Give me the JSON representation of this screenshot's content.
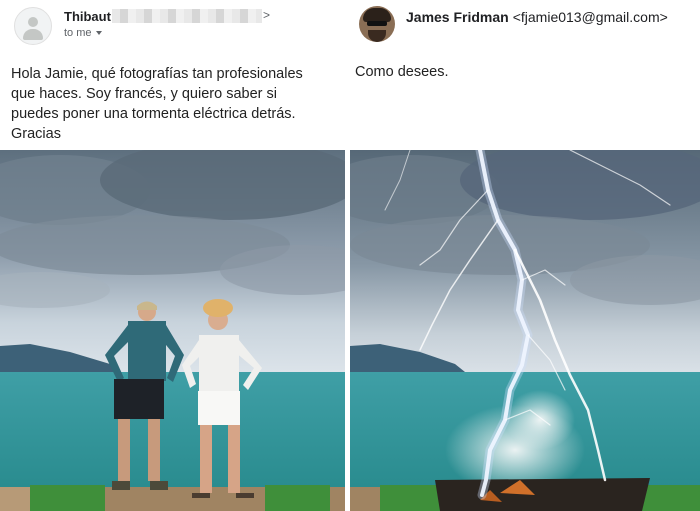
{
  "left_email": {
    "sender_name": "Thibaut",
    "redacted_tail": ">",
    "recipient_line": "to me",
    "message_lines": [
      "Hola Jamie, qué fotografías tan profesionales",
      "que haces. Soy francés, y quiero saber si",
      "puedes poner una tormenta eléctrica detrás.",
      "Gracias"
    ]
  },
  "right_email": {
    "sender_name": "James Fridman",
    "sender_email": "<fjamie013@gmail.com>",
    "message": "Como desees."
  },
  "icons": {
    "left_avatar": "person-placeholder-icon",
    "right_avatar": "profile-photo-icon",
    "recipient_caret": "chevron-down-icon"
  },
  "colors": {
    "sky_top": "#5d6f7e",
    "sea": "#2f9a9e",
    "lightning": "#ffffff",
    "grass": "#3f8f3a"
  }
}
